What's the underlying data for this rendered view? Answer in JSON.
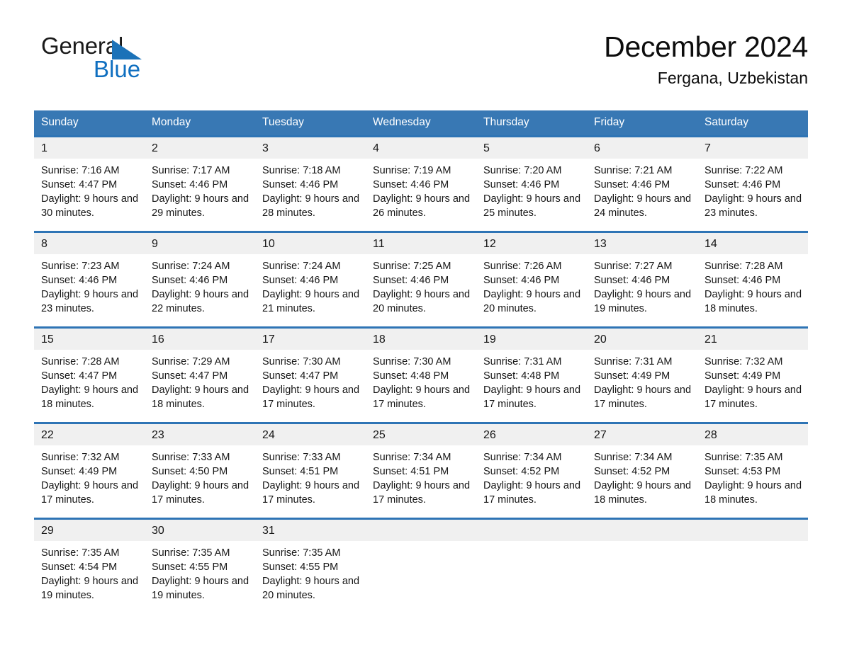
{
  "brand": {
    "word_one": "General",
    "word_two": "Blue",
    "triangle_icon": "triangle-icon",
    "accent_color": "#1b72b8",
    "text_color": "#0f6fc0"
  },
  "header": {
    "title": "December 2024",
    "location": "Fergana, Uzbekistan"
  },
  "calendar": {
    "header_bg": "#3878b4",
    "row_rule_color": "#2e74b5",
    "daynum_bg": "#f0f0f0",
    "weekday_headers": [
      "Sunday",
      "Monday",
      "Tuesday",
      "Wednesday",
      "Thursday",
      "Friday",
      "Saturday"
    ],
    "weeks": [
      [
        {
          "day": "1",
          "sunrise": "Sunrise: 7:16 AM",
          "sunset": "Sunset: 4:47 PM",
          "daylight": "Daylight: 9 hours and 30 minutes."
        },
        {
          "day": "2",
          "sunrise": "Sunrise: 7:17 AM",
          "sunset": "Sunset: 4:46 PM",
          "daylight": "Daylight: 9 hours and 29 minutes."
        },
        {
          "day": "3",
          "sunrise": "Sunrise: 7:18 AM",
          "sunset": "Sunset: 4:46 PM",
          "daylight": "Daylight: 9 hours and 28 minutes."
        },
        {
          "day": "4",
          "sunrise": "Sunrise: 7:19 AM",
          "sunset": "Sunset: 4:46 PM",
          "daylight": "Daylight: 9 hours and 26 minutes."
        },
        {
          "day": "5",
          "sunrise": "Sunrise: 7:20 AM",
          "sunset": "Sunset: 4:46 PM",
          "daylight": "Daylight: 9 hours and 25 minutes."
        },
        {
          "day": "6",
          "sunrise": "Sunrise: 7:21 AM",
          "sunset": "Sunset: 4:46 PM",
          "daylight": "Daylight: 9 hours and 24 minutes."
        },
        {
          "day": "7",
          "sunrise": "Sunrise: 7:22 AM",
          "sunset": "Sunset: 4:46 PM",
          "daylight": "Daylight: 9 hours and 23 minutes."
        }
      ],
      [
        {
          "day": "8",
          "sunrise": "Sunrise: 7:23 AM",
          "sunset": "Sunset: 4:46 PM",
          "daylight": "Daylight: 9 hours and 23 minutes."
        },
        {
          "day": "9",
          "sunrise": "Sunrise: 7:24 AM",
          "sunset": "Sunset: 4:46 PM",
          "daylight": "Daylight: 9 hours and 22 minutes."
        },
        {
          "day": "10",
          "sunrise": "Sunrise: 7:24 AM",
          "sunset": "Sunset: 4:46 PM",
          "daylight": "Daylight: 9 hours and 21 minutes."
        },
        {
          "day": "11",
          "sunrise": "Sunrise: 7:25 AM",
          "sunset": "Sunset: 4:46 PM",
          "daylight": "Daylight: 9 hours and 20 minutes."
        },
        {
          "day": "12",
          "sunrise": "Sunrise: 7:26 AM",
          "sunset": "Sunset: 4:46 PM",
          "daylight": "Daylight: 9 hours and 20 minutes."
        },
        {
          "day": "13",
          "sunrise": "Sunrise: 7:27 AM",
          "sunset": "Sunset: 4:46 PM",
          "daylight": "Daylight: 9 hours and 19 minutes."
        },
        {
          "day": "14",
          "sunrise": "Sunrise: 7:28 AM",
          "sunset": "Sunset: 4:46 PM",
          "daylight": "Daylight: 9 hours and 18 minutes."
        }
      ],
      [
        {
          "day": "15",
          "sunrise": "Sunrise: 7:28 AM",
          "sunset": "Sunset: 4:47 PM",
          "daylight": "Daylight: 9 hours and 18 minutes."
        },
        {
          "day": "16",
          "sunrise": "Sunrise: 7:29 AM",
          "sunset": "Sunset: 4:47 PM",
          "daylight": "Daylight: 9 hours and 18 minutes."
        },
        {
          "day": "17",
          "sunrise": "Sunrise: 7:30 AM",
          "sunset": "Sunset: 4:47 PM",
          "daylight": "Daylight: 9 hours and 17 minutes."
        },
        {
          "day": "18",
          "sunrise": "Sunrise: 7:30 AM",
          "sunset": "Sunset: 4:48 PM",
          "daylight": "Daylight: 9 hours and 17 minutes."
        },
        {
          "day": "19",
          "sunrise": "Sunrise: 7:31 AM",
          "sunset": "Sunset: 4:48 PM",
          "daylight": "Daylight: 9 hours and 17 minutes."
        },
        {
          "day": "20",
          "sunrise": "Sunrise: 7:31 AM",
          "sunset": "Sunset: 4:49 PM",
          "daylight": "Daylight: 9 hours and 17 minutes."
        },
        {
          "day": "21",
          "sunrise": "Sunrise: 7:32 AM",
          "sunset": "Sunset: 4:49 PM",
          "daylight": "Daylight: 9 hours and 17 minutes."
        }
      ],
      [
        {
          "day": "22",
          "sunrise": "Sunrise: 7:32 AM",
          "sunset": "Sunset: 4:49 PM",
          "daylight": "Daylight: 9 hours and 17 minutes."
        },
        {
          "day": "23",
          "sunrise": "Sunrise: 7:33 AM",
          "sunset": "Sunset: 4:50 PM",
          "daylight": "Daylight: 9 hours and 17 minutes."
        },
        {
          "day": "24",
          "sunrise": "Sunrise: 7:33 AM",
          "sunset": "Sunset: 4:51 PM",
          "daylight": "Daylight: 9 hours and 17 minutes."
        },
        {
          "day": "25",
          "sunrise": "Sunrise: 7:34 AM",
          "sunset": "Sunset: 4:51 PM",
          "daylight": "Daylight: 9 hours and 17 minutes."
        },
        {
          "day": "26",
          "sunrise": "Sunrise: 7:34 AM",
          "sunset": "Sunset: 4:52 PM",
          "daylight": "Daylight: 9 hours and 17 minutes."
        },
        {
          "day": "27",
          "sunrise": "Sunrise: 7:34 AM",
          "sunset": "Sunset: 4:52 PM",
          "daylight": "Daylight: 9 hours and 18 minutes."
        },
        {
          "day": "28",
          "sunrise": "Sunrise: 7:35 AM",
          "sunset": "Sunset: 4:53 PM",
          "daylight": "Daylight: 9 hours and 18 minutes."
        }
      ],
      [
        {
          "day": "29",
          "sunrise": "Sunrise: 7:35 AM",
          "sunset": "Sunset: 4:54 PM",
          "daylight": "Daylight: 9 hours and 19 minutes."
        },
        {
          "day": "30",
          "sunrise": "Sunrise: 7:35 AM",
          "sunset": "Sunset: 4:55 PM",
          "daylight": "Daylight: 9 hours and 19 minutes."
        },
        {
          "day": "31",
          "sunrise": "Sunrise: 7:35 AM",
          "sunset": "Sunset: 4:55 PM",
          "daylight": "Daylight: 9 hours and 20 minutes."
        },
        {
          "day": "",
          "sunrise": "",
          "sunset": "",
          "daylight": ""
        },
        {
          "day": "",
          "sunrise": "",
          "sunset": "",
          "daylight": ""
        },
        {
          "day": "",
          "sunrise": "",
          "sunset": "",
          "daylight": ""
        },
        {
          "day": "",
          "sunrise": "",
          "sunset": "",
          "daylight": ""
        }
      ]
    ]
  }
}
